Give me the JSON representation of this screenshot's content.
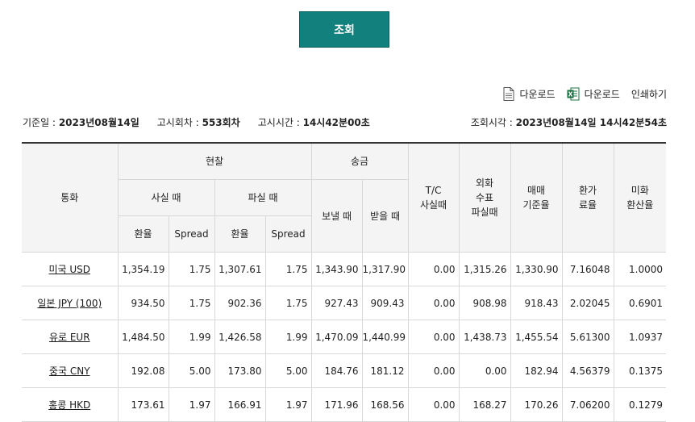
{
  "actions": {
    "search_label": "조회",
    "download_pdf_label": "다운로드",
    "download_excel_label": "다운로드",
    "print_label": "인쇄하기"
  },
  "info": {
    "base_date_label": "기준일 :",
    "base_date_value": "2023년08월14일",
    "notice_round_label": "고시회차 :",
    "notice_round_value": "553회차",
    "notice_time_label": "고시시간 :",
    "notice_time_value": "14시42분00초",
    "query_time_label": "조회시각 :",
    "query_time_value": "2023년08월14일 14시42분54초"
  },
  "table": {
    "headers": {
      "currency": "통화",
      "cash": "현찰",
      "cash_buy": "사실 때",
      "cash_sell": "파실 때",
      "rate": "환율",
      "spread": "Spread",
      "remit": "송금",
      "remit_send": "보낼 때",
      "remit_receive": "받을 때",
      "tc_buy": "T/C\n사실때",
      "check_sell": "외화\n수표\n파실때",
      "base_rate": "매매\n기준율",
      "conv_rate": "환가\n료율",
      "usd_rate": "미화\n환산율"
    },
    "rows": [
      {
        "currency": "미국 USD",
        "cash_buy_rate": "1,354.19",
        "cash_buy_spread": "1.75",
        "cash_sell_rate": "1,307.61",
        "cash_sell_spread": "1.75",
        "send": "1,343.90",
        "receive": "1,317.90",
        "tc": "0.00",
        "check": "1,315.26",
        "base": "1,330.90",
        "conv": "7.16048",
        "usd": "1.0000"
      },
      {
        "currency": "일본 JPY (100)",
        "cash_buy_rate": "934.50",
        "cash_buy_spread": "1.75",
        "cash_sell_rate": "902.36",
        "cash_sell_spread": "1.75",
        "send": "927.43",
        "receive": "909.43",
        "tc": "0.00",
        "check": "908.98",
        "base": "918.43",
        "conv": "2.02045",
        "usd": "0.6901"
      },
      {
        "currency": "유로 EUR",
        "cash_buy_rate": "1,484.50",
        "cash_buy_spread": "1.99",
        "cash_sell_rate": "1,426.58",
        "cash_sell_spread": "1.99",
        "send": "1,470.09",
        "receive": "1,440.99",
        "tc": "0.00",
        "check": "1,438.73",
        "base": "1,455.54",
        "conv": "5.61300",
        "usd": "1.0937"
      },
      {
        "currency": "중국 CNY",
        "cash_buy_rate": "192.08",
        "cash_buy_spread": "5.00",
        "cash_sell_rate": "173.80",
        "cash_sell_spread": "5.00",
        "send": "184.76",
        "receive": "181.12",
        "tc": "0.00",
        "check": "0.00",
        "base": "182.94",
        "conv": "4.56379",
        "usd": "0.1375"
      },
      {
        "currency": "홍콩 HKD",
        "cash_buy_rate": "173.61",
        "cash_buy_spread": "1.97",
        "cash_sell_rate": "166.91",
        "cash_sell_spread": "1.97",
        "send": "171.96",
        "receive": "168.56",
        "tc": "0.00",
        "check": "168.27",
        "base": "170.26",
        "conv": "7.06200",
        "usd": "0.1279"
      }
    ]
  },
  "colors": {
    "search_button_bg": "#12807c",
    "header_bg": "#f4f4f4",
    "table_top_border": "#333333"
  }
}
